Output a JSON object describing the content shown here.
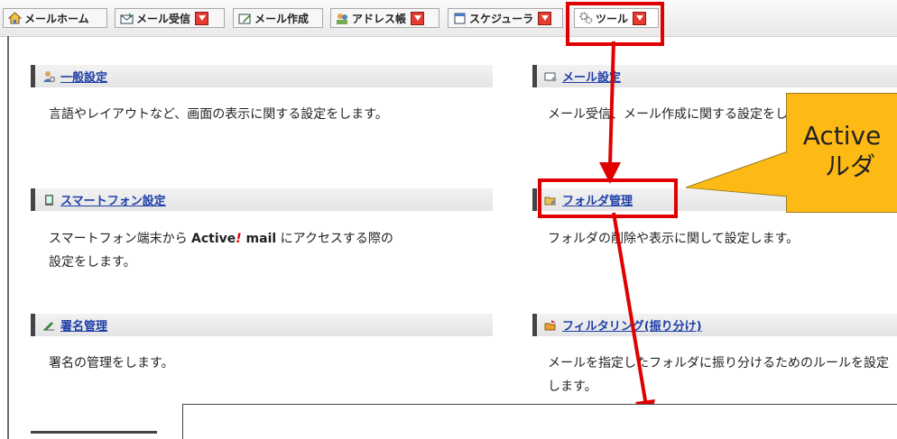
{
  "tabs": [
    {
      "label": "メールホーム",
      "icon": "home-icon",
      "dropdown": false
    },
    {
      "label": "メール受信",
      "icon": "mail-receive-icon",
      "dropdown": true
    },
    {
      "label": "メール作成",
      "icon": "mail-compose-icon",
      "dropdown": false
    },
    {
      "label": "アドレス帳",
      "icon": "address-book-icon",
      "dropdown": true
    },
    {
      "label": "スケジューラ",
      "icon": "scheduler-icon",
      "dropdown": true
    },
    {
      "label": "ツール",
      "icon": "gear-icon",
      "dropdown": true
    }
  ],
  "sections": {
    "general": {
      "title": "一般設定",
      "icon": "user-settings-icon",
      "desc": "言語やレイアウトなど、画面の表示に関する設定をします。"
    },
    "mail": {
      "title": "メール設定",
      "icon": "mail-settings-icon",
      "desc": "メール受信、メール作成に関する設定をします。"
    },
    "smartphone": {
      "title": "スマートフォン設定",
      "icon": "smartphone-icon",
      "desc_pre": "スマートフォン端末から ",
      "brand_a": "Active",
      "brand_bang": "!",
      "brand_b": " mail",
      "desc_post": " にアクセスする際の",
      "desc_line2": "設定をします。"
    },
    "folder": {
      "title": "フォルダ管理",
      "icon": "folder-manage-icon",
      "desc": "フォルダの削除や表示に関して設定します。"
    },
    "signature": {
      "title": "署名管理",
      "icon": "pen-icon",
      "desc": "署名の管理をします。"
    },
    "filter": {
      "title": "フィルタリング(振り分け)",
      "icon": "filter-icon",
      "desc": "メールを指定したフォルダに振り分けるためのルールを設定",
      "desc_line2": "します。"
    }
  },
  "callout": {
    "line1": "Active",
    "line2": "ルダ"
  },
  "colors": {
    "highlight": "#e00000",
    "callout": "#fdba14",
    "link": "#1f3fa8"
  }
}
